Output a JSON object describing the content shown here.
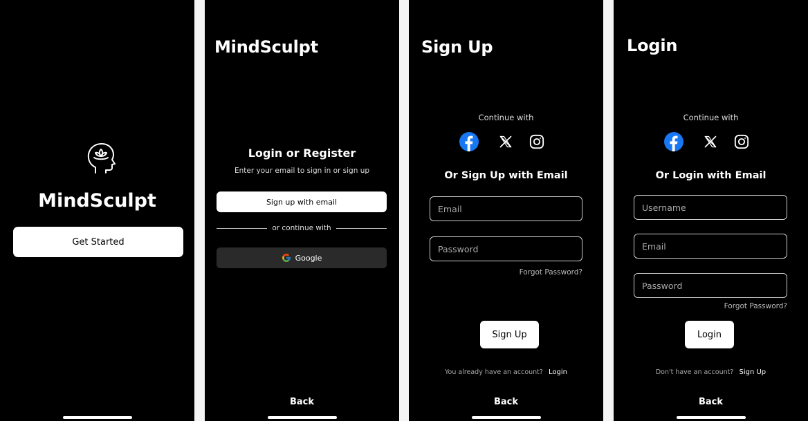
{
  "welcome": {
    "app_name": "MindSculpt",
    "get_started": "Get Started",
    "icon": "head-lotus-icon"
  },
  "register": {
    "app_name": "MindSculpt",
    "heading": "Login or Register",
    "subtext": "Enter your email to sign in or sign up",
    "signup_email_button": "Sign up with email",
    "divider_text": "or continue with",
    "google_button": "Google",
    "back": "Back"
  },
  "signup": {
    "title": "Sign Up",
    "continue_with": "Continue with",
    "or_email": "Or Sign Up with Email",
    "email_placeholder": "Email",
    "password_placeholder": "Password",
    "forgot": "Forgot Password?",
    "submit": "Sign Up",
    "have_account": "You already have an account?",
    "login_link": "Login",
    "back": "Back"
  },
  "login": {
    "title": "Login",
    "continue_with": "Continue with",
    "or_email": "Or Login with Email",
    "username_placeholder": "Username",
    "email_placeholder": "Email",
    "password_placeholder": "Password",
    "forgot": "Forgot Password?",
    "submit": "Login",
    "no_account": "Don't have an account?",
    "signup_link": "Sign Up",
    "back": "Back"
  },
  "colors": {
    "background": "#000000",
    "facebook": "#1877F2",
    "google_button_bg": "#2a2a2a"
  }
}
